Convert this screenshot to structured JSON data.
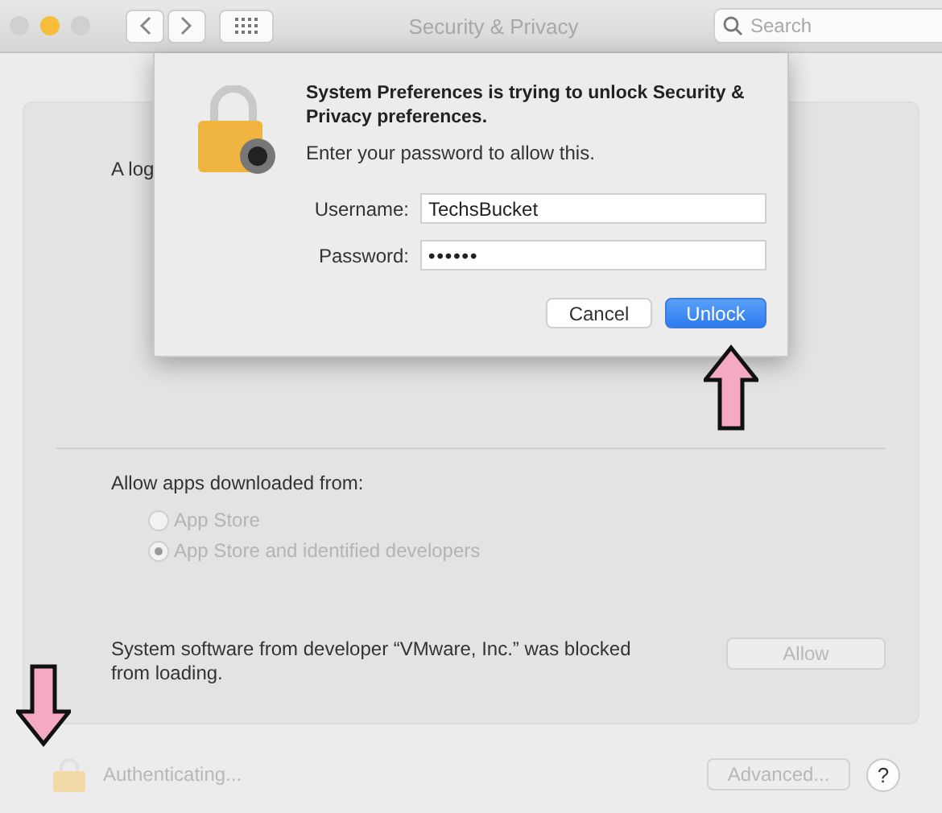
{
  "window": {
    "title": "Security & Privacy",
    "search": {
      "placeholder": "Search"
    }
  },
  "background": {
    "fragments": [
      "A log"
    ],
    "gatekeeper": {
      "label": "Allow apps downloaded from:",
      "options": [
        {
          "label": "App Store",
          "selected": false,
          "disabled": true
        },
        {
          "label": "App Store and identified developers",
          "selected": true,
          "disabled": true
        }
      ]
    },
    "blocked": {
      "message": "System software from developer “VMware, Inc.” was blocked from loading.",
      "button": {
        "label": "Allow",
        "disabled": true
      }
    }
  },
  "footer": {
    "status": "Authenticating...",
    "advanced": {
      "label": "Advanced...",
      "disabled": true
    },
    "help": "?"
  },
  "sheet": {
    "heading": "System Preferences is trying to unlock Security & Privacy preferences.",
    "prompt": "Enter your password to allow this.",
    "fields": [
      {
        "label": "Username:",
        "value": "TechsBucket",
        "kind": "text"
      },
      {
        "label": "Password:",
        "value": "••••••",
        "kind": "password"
      }
    ],
    "buttons": [
      {
        "label": "Cancel",
        "kind": "secondary"
      },
      {
        "label": "Unlock",
        "kind": "default"
      }
    ]
  },
  "annotations": [
    {
      "kind": "up"
    },
    {
      "kind": "down"
    }
  ]
}
